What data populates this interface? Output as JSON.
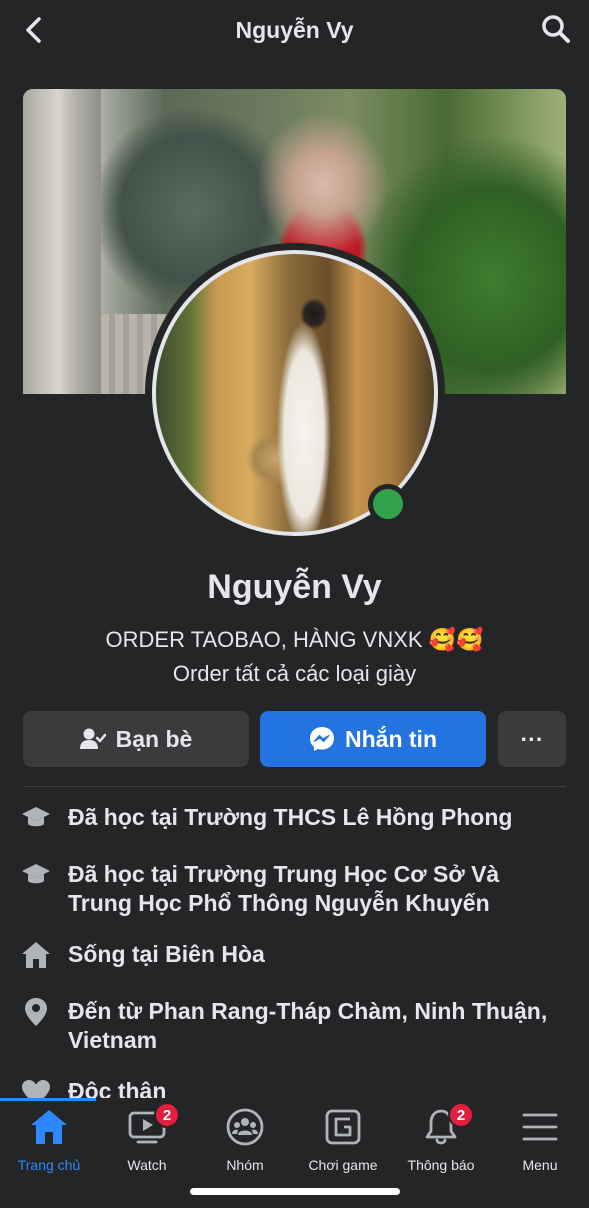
{
  "header": {
    "title": "Nguyễn Vy"
  },
  "profile": {
    "name": "Nguyễn Vy",
    "bio_line1": "ORDER TAOBAO, HÀNG VNXK 🥰🥰",
    "bio_line2": "Order tất cả các loại giày",
    "online_color": "#31a24c"
  },
  "actions": {
    "friends_label": "Bạn bè",
    "message_label": "Nhắn tin",
    "more_label": "···",
    "message_color": "#2374e1"
  },
  "info": [
    {
      "icon": "graduation-cap-icon",
      "text": "Đã học tại Trường THCS Lê Hồng Phong"
    },
    {
      "icon": "graduation-cap-icon",
      "text": "Đã học tại Trường Trung Học Cơ Sở Và Trung Học Phổ Thông Nguyễn Khuyến"
    },
    {
      "icon": "home-icon",
      "text": "Sống tại Biên Hòa"
    },
    {
      "icon": "location-pin-icon",
      "text": "Đến từ Phan Rang-Tháp Chàm, Ninh Thuận, Vietnam"
    },
    {
      "icon": "heart-icon",
      "text": "Độc thân"
    }
  ],
  "bottom_nav": [
    {
      "label": "Trang chủ",
      "icon": "home-icon",
      "active": true,
      "badge": ""
    },
    {
      "label": "Watch",
      "icon": "watch-video-icon",
      "active": false,
      "badge": "2"
    },
    {
      "label": "Nhóm",
      "icon": "groups-icon",
      "active": false,
      "badge": ""
    },
    {
      "label": "Chơi game",
      "icon": "gaming-icon",
      "active": false,
      "badge": ""
    },
    {
      "label": "Thông báo",
      "icon": "bell-icon",
      "active": false,
      "badge": "2"
    },
    {
      "label": "Menu",
      "icon": "menu-icon",
      "active": false,
      "badge": ""
    }
  ],
  "colors": {
    "background": "#242526",
    "accent": "#2d88ff",
    "badge": "#e41e3f"
  }
}
